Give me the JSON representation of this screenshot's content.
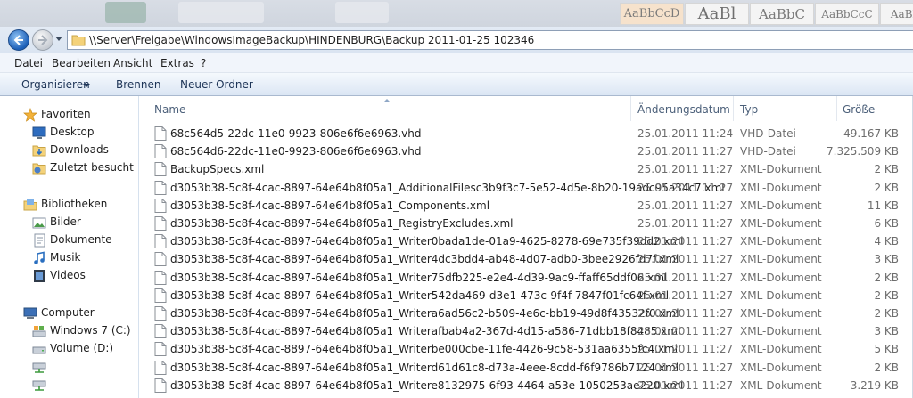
{
  "background_strip": {
    "styles": [
      "AaBbCcD",
      "AaBl",
      "AaBbC",
      "AaBbCcC",
      "AaBbCc"
    ]
  },
  "address": {
    "path": "\\\\Server\\Freigabe\\WindowsImageBackup\\HINDENBURG\\Backup 2011-01-25 102346"
  },
  "menu": [
    "Datei",
    "Bearbeiten",
    "Ansicht",
    "Extras",
    "?"
  ],
  "commands": {
    "organize": "Organisieren",
    "burn": "Brennen",
    "new_folder": "Neuer Ordner"
  },
  "nav": {
    "favorites": "Favoriten",
    "desktop": "Desktop",
    "downloads": "Downloads",
    "recent": "Zuletzt besucht",
    "libraries": "Bibliotheken",
    "pictures": "Bilder",
    "documents": "Dokumente",
    "music": "Musik",
    "videos": "Videos",
    "computer": "Computer",
    "drive_c": "Windows 7 (C:)",
    "drive_d": "Volume (D:)"
  },
  "columns": {
    "name": "Name",
    "date": "Änderungsdatum",
    "type": "Typ",
    "size": "Größe"
  },
  "files": [
    {
      "name": "68c564d5-22dc-11e0-9923-806e6f6e6963.vhd",
      "date": "25.01.2011 11:24",
      "type": "VHD-Datei",
      "size": "49.167 KB"
    },
    {
      "name": "68c564d6-22dc-11e0-9923-806e6f6e6963.vhd",
      "date": "25.01.2011 11:27",
      "type": "VHD-Datei",
      "size": "7.325.509 KB"
    },
    {
      "name": "BackupSpecs.xml",
      "date": "25.01.2011 11:27",
      "type": "XML-Dokument",
      "size": "2 KB"
    },
    {
      "name": "d3053b38-5c8f-4cac-8897-64e64b8f05a1_AdditionalFilesc3b9f3c7-5e52-4d5e-8b20-19adc95a34c7.xml",
      "date": "25.01.2011 11:27",
      "type": "XML-Dokument",
      "size": "2 KB"
    },
    {
      "name": "d3053b38-5c8f-4cac-8897-64e64b8f05a1_Components.xml",
      "date": "25.01.2011 11:27",
      "type": "XML-Dokument",
      "size": "11 KB"
    },
    {
      "name": "d3053b38-5c8f-4cac-8897-64e64b8f05a1_RegistryExcludes.xml",
      "date": "25.01.2011 11:27",
      "type": "XML-Dokument",
      "size": "6 KB"
    },
    {
      "name": "d3053b38-5c8f-4cac-8897-64e64b8f05a1_Writer0bada1de-01a9-4625-8278-69e735f39dd2.xml",
      "date": "25.01.2011 11:27",
      "type": "XML-Dokument",
      "size": "4 KB"
    },
    {
      "name": "d3053b38-5c8f-4cac-8897-64e64b8f05a1_Writer4dc3bdd4-ab48-4d07-adb0-3bee2926fd7f.xml",
      "date": "25.01.2011 11:27",
      "type": "XML-Dokument",
      "size": "3 KB"
    },
    {
      "name": "d3053b38-5c8f-4cac-8897-64e64b8f05a1_Writer75dfb225-e2e4-4d39-9ac9-ffaff65ddf06.xml",
      "date": "25.01.2011 11:27",
      "type": "XML-Dokument",
      "size": "2 KB"
    },
    {
      "name": "d3053b38-5c8f-4cac-8897-64e64b8f05a1_Writer542da469-d3e1-473c-9f4f-7847f01fc64f.xml",
      "date": "25.01.2011 11:27",
      "type": "XML-Dokument",
      "size": "2 KB"
    },
    {
      "name": "d3053b38-5c8f-4cac-8897-64e64b8f05a1_Writera6ad56c2-b509-4e6c-bb19-49d8f43532f0.xml",
      "date": "25.01.2011 11:27",
      "type": "XML-Dokument",
      "size": "2 KB"
    },
    {
      "name": "d3053b38-5c8f-4cac-8897-64e64b8f05a1_Writerafbab4a2-367d-4d15-a586-71dbb18f8485.xml",
      "date": "25.01.2011 11:27",
      "type": "XML-Dokument",
      "size": "3 KB"
    },
    {
      "name": "d3053b38-5c8f-4cac-8897-64e64b8f05a1_Writerbe000cbe-11fe-4426-9c58-531aa6355fc4.xml",
      "date": "25.01.2011 11:27",
      "type": "XML-Dokument",
      "size": "5 KB"
    },
    {
      "name": "d3053b38-5c8f-4cac-8897-64e64b8f05a1_Writerd61d61c8-d73a-4eee-8cdd-f6f9786b7124.xml",
      "date": "25.01.2011 11:27",
      "type": "XML-Dokument",
      "size": "2 KB"
    },
    {
      "name": "d3053b38-5c8f-4cac-8897-64e64b8f05a1_Writere8132975-6f93-4464-a53e-1050253ae220.xml",
      "date": "25.01.2011 11:27",
      "type": "XML-Dokument",
      "size": "3.219 KB"
    }
  ]
}
